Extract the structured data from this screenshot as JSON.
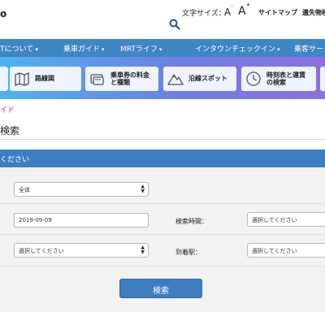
{
  "header": {
    "logo_fragment": "o",
    "font_size_label": "文字サイズ：",
    "font_small": "A",
    "font_small_sign": "-",
    "font_large": "A",
    "font_large_sign": "+",
    "sitemap": "サイトマップ",
    "lost_found": "遺失物検"
  },
  "nav": {
    "items": [
      {
        "label": "Tについて",
        "caret": "▾"
      },
      {
        "label": "乗車ガイド",
        "caret": "▾"
      },
      {
        "label": "MRTライフ",
        "caret": "▾"
      },
      {
        "label": "インタウンチェックイン",
        "caret": "▾"
      },
      {
        "label": "乗客サー",
        "caret": ""
      }
    ]
  },
  "quick": [
    {
      "label": "路線図",
      "icon": "map-icon"
    },
    {
      "label": "乗車券の料金\nと種類",
      "icon": "ticket-icon"
    },
    {
      "label": "沿線スポット",
      "icon": "mountain-icon"
    },
    {
      "label": "時刻表と運賃\nの検索",
      "icon": "clock-icon"
    }
  ],
  "breadcrumb": "イド",
  "page_title": "検索",
  "panel": {
    "header": "ください",
    "line_select": {
      "value": "全体"
    },
    "date": {
      "value": "2019-09-09"
    },
    "time_label": "検索時間：",
    "time_select": {
      "value": "選択してください"
    },
    "depart_select": {
      "value": "選択してください"
    },
    "arrive_label": "到着駅：",
    "arrive_select": {
      "value": "選択してください"
    },
    "search_button": "検索"
  },
  "colors": {
    "nav_bg": "#3f86c5",
    "panel_header_bg": "#3c7ec0",
    "breadcrumb": "#c2278a",
    "quick_gradient_start": "#4fb2ee",
    "quick_gradient_end": "#8e6fe0"
  }
}
